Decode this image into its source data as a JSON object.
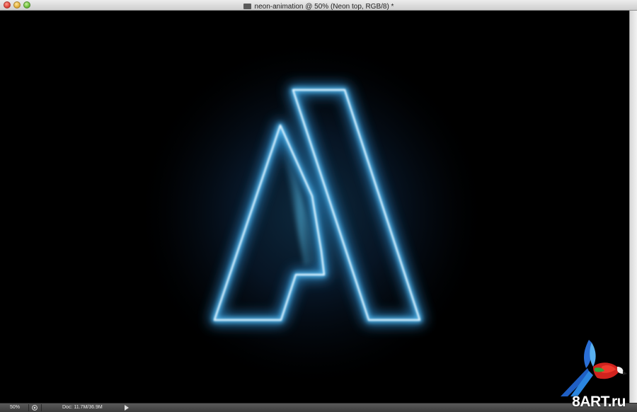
{
  "window": {
    "title": "neon-animation @ 50% (Neon top, RGB/8) *"
  },
  "status": {
    "zoom": "50%",
    "doc_info": "Doc: 11.7M/36.9M"
  },
  "watermark": {
    "text": "8ART.ru"
  },
  "colors": {
    "neon_glow": "#4fb6ee",
    "neon_core": "#e6f7ff",
    "canvas_bg": "#000000",
    "status_bar": "#474747"
  },
  "icons": [
    "close-button",
    "minimize-button",
    "zoom-button",
    "document-icon",
    "status-info-icon",
    "status-menu-arrow-icon",
    "parrot-logo"
  ]
}
